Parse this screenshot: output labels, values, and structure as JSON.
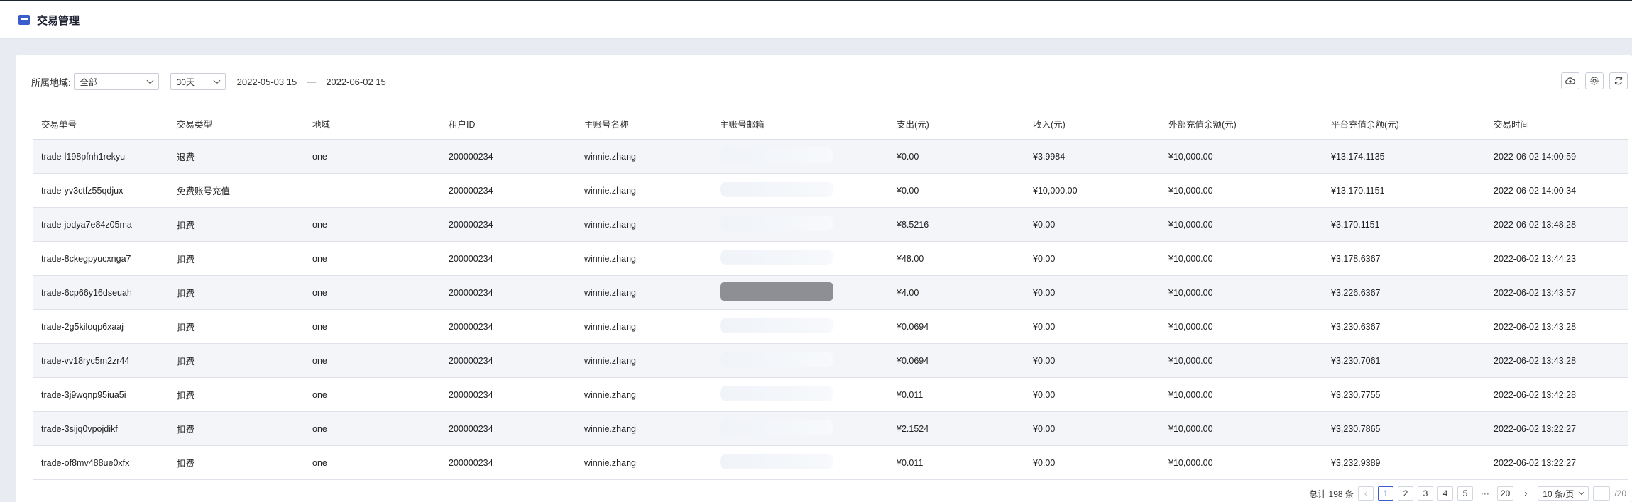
{
  "header": {
    "title": "交易管理",
    "icon": "app-logo-icon"
  },
  "filters": {
    "region_label": "所属地域:",
    "region_value": "全部",
    "period_value": "30天",
    "date_start": "2022-05-03 15",
    "date_sep": "—",
    "date_end": "2022-06-02 15"
  },
  "toolbar": {
    "icons": [
      "cloud-upload-icon",
      "settings-icon",
      "refresh-icon"
    ]
  },
  "table": {
    "columns": [
      "交易单号",
      "交易类型",
      "地域",
      "租户ID",
      "主账号名称",
      "主账号邮箱",
      "支出(元)",
      "收入(元)",
      "外部充值余额(元)",
      "平台充值余额(元)",
      "交易时间"
    ],
    "rows": [
      [
        "trade-l198pfnh1rekyu",
        "退费",
        "one",
        "200000234",
        "winnie.zhang",
        "",
        "¥0.00",
        "¥3.9984",
        "¥10,000.00",
        "¥13,174.1135",
        "2022-06-02 14:00:59"
      ],
      [
        "trade-yv3ctfz55qdjux",
        "免费账号充值",
        "-",
        "200000234",
        "winnie.zhang",
        "",
        "¥0.00",
        "¥10,000.00",
        "¥10,000.00",
        "¥13,170.1151",
        "2022-06-02 14:00:34"
      ],
      [
        "trade-jodya7e84z05ma",
        "扣费",
        "one",
        "200000234",
        "winnie.zhang",
        "",
        "¥8.5216",
        "¥0.00",
        "¥10,000.00",
        "¥3,170.1151",
        "2022-06-02 13:48:28"
      ],
      [
        "trade-8ckegpyucxnga7",
        "扣费",
        "one",
        "200000234",
        "winnie.zhang",
        "",
        "¥48.00",
        "¥0.00",
        "¥10,000.00",
        "¥3,178.6367",
        "2022-06-02 13:44:23"
      ],
      [
        "trade-6cp66y16dseuah",
        "扣费",
        "one",
        "200000234",
        "winnie.zhang",
        "",
        "¥4.00",
        "¥0.00",
        "¥10,000.00",
        "¥3,226.6367",
        "2022-06-02 13:43:57"
      ],
      [
        "trade-2g5kiloqp6xaaj",
        "扣费",
        "one",
        "200000234",
        "winnie.zhang",
        "",
        "¥0.0694",
        "¥0.00",
        "¥10,000.00",
        "¥3,230.6367",
        "2022-06-02 13:43:28"
      ],
      [
        "trade-vv18ryc5m2zr44",
        "扣费",
        "one",
        "200000234",
        "winnie.zhang",
        "",
        "¥0.0694",
        "¥0.00",
        "¥10,000.00",
        "¥3,230.7061",
        "2022-06-02 13:43:28"
      ],
      [
        "trade-3j9wqnp95iua5i",
        "扣费",
        "one",
        "200000234",
        "winnie.zhang",
        "",
        "¥0.011",
        "¥0.00",
        "¥10,000.00",
        "¥3,230.7755",
        "2022-06-02 13:42:28"
      ],
      [
        "trade-3sijq0vpojdikf",
        "扣费",
        "one",
        "200000234",
        "winnie.zhang",
        "",
        "¥2.1524",
        "¥0.00",
        "¥10,000.00",
        "¥3,230.7865",
        "2022-06-02 13:22:27"
      ],
      [
        "trade-of8mv488ue0xfx",
        "扣费",
        "one",
        "200000234",
        "winnie.zhang",
        "",
        "¥0.011",
        "¥0.00",
        "¥10,000.00",
        "¥3,232.9389",
        "2022-06-02 13:22:27"
      ]
    ]
  },
  "pagination": {
    "total": "总计 198 条",
    "prev": "‹",
    "pages": [
      "1",
      "2",
      "3",
      "4",
      "5"
    ],
    "ellipsis": "···",
    "last_page": "20",
    "next": "›",
    "page_size": "10 条/页",
    "jump_suffix": "/20",
    "current": 1
  },
  "colors": {
    "accent": "#3b5ccc",
    "stripe": "#f4f5f8",
    "background": "#e8ebf2"
  }
}
